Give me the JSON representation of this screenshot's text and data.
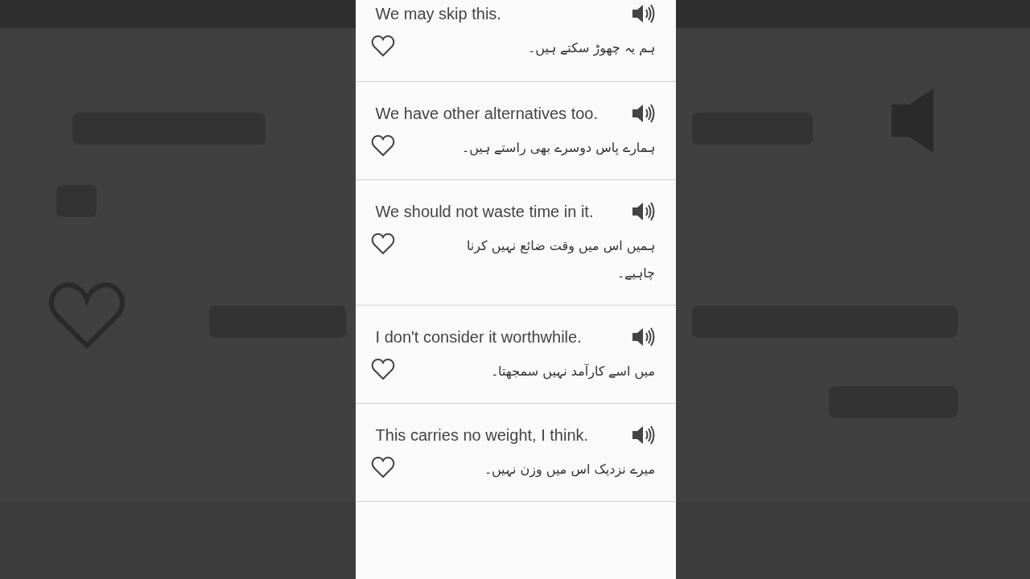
{
  "phrases": [
    {
      "english": "We may skip this.",
      "urdu": "ہم یہ چھوڑ سکتے ہیں۔",
      "favorite": false
    },
    {
      "english": "We have other alternatives too.",
      "urdu": "ہمارے پاس دوسرے بھی راستے ہیں۔",
      "favorite": false
    },
    {
      "english": "We should not waste time in it.",
      "urdu": "ہمیں اس میں وقت ضائع نہیں کرنا چاہیے۔",
      "favorite": false
    },
    {
      "english": "I don't consider it worthwhile.",
      "urdu": "میں اسے کارآمد نہیں سمجھتا۔",
      "favorite": false
    },
    {
      "english": "This carries no weight, I think.",
      "urdu": "میرے نزدیک اس میں وزن نہیں۔",
      "favorite": false
    }
  ]
}
